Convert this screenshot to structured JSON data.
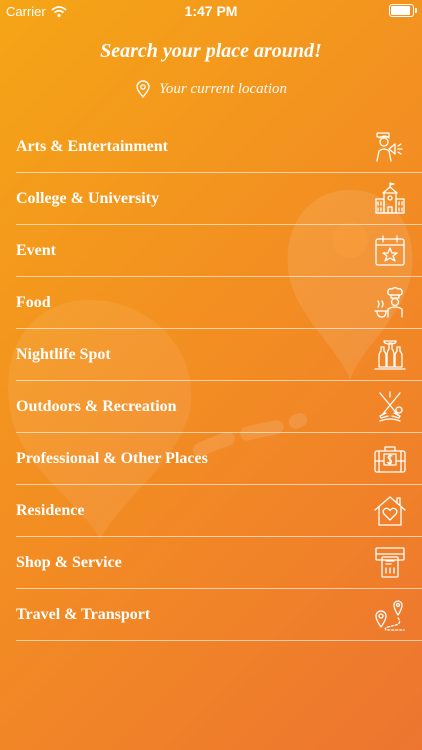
{
  "status": {
    "carrier": "Carrier",
    "time": "1:47 PM"
  },
  "header": {
    "title": "Search your place around!",
    "location_label": "Your current location"
  },
  "categories": [
    {
      "label": "Arts & Entertainment",
      "icon": "megaphone-person-icon"
    },
    {
      "label": "College & University",
      "icon": "school-building-icon"
    },
    {
      "label": "Event",
      "icon": "calendar-star-icon"
    },
    {
      "label": "Food",
      "icon": "chef-icon"
    },
    {
      "label": "Nightlife Spot",
      "icon": "bottles-icon"
    },
    {
      "label": "Outdoors & Recreation",
      "icon": "golf-icon"
    },
    {
      "label": "Professional & Other Places",
      "icon": "briefcase-dollar-icon"
    },
    {
      "label": "Residence",
      "icon": "house-heart-icon"
    },
    {
      "label": "Shop & Service",
      "icon": "atm-card-icon"
    },
    {
      "label": "Travel & Transport",
      "icon": "route-pins-icon"
    }
  ],
  "colors": {
    "gradient_start": "#f5a516",
    "gradient_end": "#ed7530",
    "text": "#ffffff"
  }
}
